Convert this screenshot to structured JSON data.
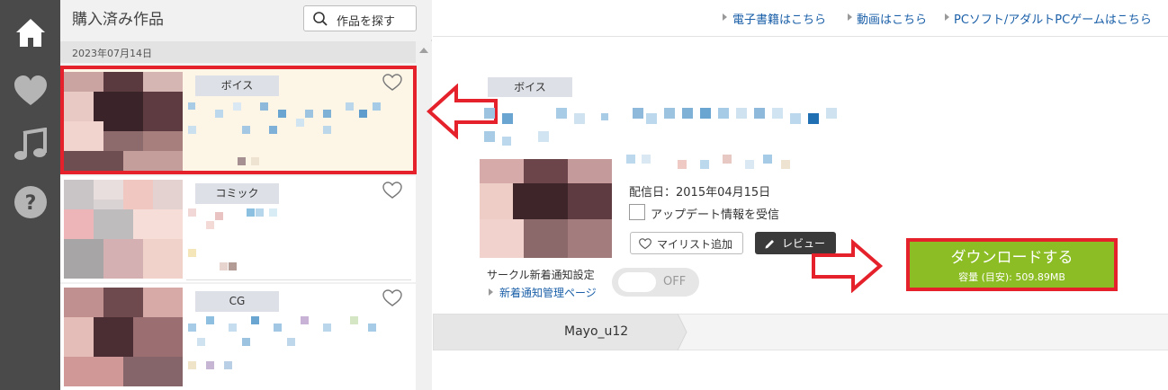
{
  "sidebar": {
    "icons": [
      "home-icon",
      "heart-icon",
      "music-icon",
      "help-icon"
    ]
  },
  "list": {
    "title": "購入済み作品",
    "find_button": "作品を探す",
    "date": "2023年07月14日",
    "items": [
      {
        "tag": "ボイス",
        "selected": true
      },
      {
        "tag": "コミック",
        "selected": false
      },
      {
        "tag": "CG",
        "selected": false
      }
    ]
  },
  "topnav": {
    "links": [
      "電子書籍はこちら",
      "動画はこちら",
      "PCソフト/アダルトPCゲームはこちら"
    ]
  },
  "detail": {
    "tag": "ボイス",
    "release": "配信日：2015年04月15日",
    "update_checkbox": "アップデート情報を受信",
    "mylist_button": "マイリスト追加",
    "review_button": "レビュー",
    "circle_label": "サークル新着通知設定",
    "circle_link": "新着通知管理ページ",
    "toggle_label": "OFF",
    "download_label": "ダウンロードする",
    "download_size": "容量 (目安): 509.89MB",
    "crumb": "Mayo_u12"
  },
  "colors": {
    "rail": "#4a4a4a",
    "accent_red": "#e5222b",
    "download_green": "#8cbd24",
    "link_blue": "#1a5fa8"
  }
}
